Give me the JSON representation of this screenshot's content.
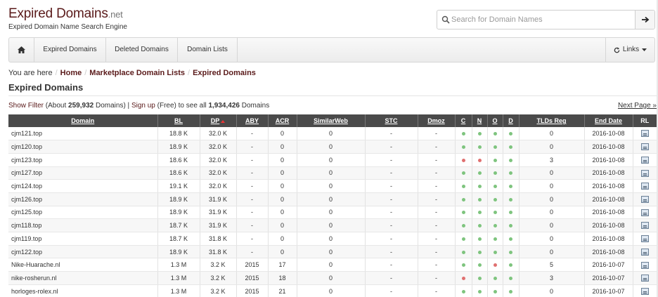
{
  "header": {
    "logo_main": "Expired Domains",
    "logo_tld": ".net",
    "tagline": "Expired Domain Name Search Engine",
    "search_placeholder": "Search for Domain Names"
  },
  "nav": {
    "items": [
      "Expired Domains",
      "Deleted Domains",
      "Domain Lists"
    ],
    "links_label": "Links"
  },
  "breadcrumb": {
    "prefix": "You are here",
    "items": [
      "Home",
      "Marketplace Domain Lists",
      "Expired Domains"
    ]
  },
  "page_title": "Expired Domains",
  "info": {
    "show_filter": "Show Filter",
    "about_prefix": "(About ",
    "count": "259,932",
    "count_suffix": " Domains) | ",
    "sign_up": "Sign up",
    "free_text": " (Free) to see all ",
    "total": "1,934,426",
    "total_suffix": " Domains",
    "next_page": "Next Page »"
  },
  "table": {
    "columns": [
      "Domain",
      "BL",
      "DP",
      "ABY",
      "ACR",
      "SimilarWeb",
      "STC",
      "Dmoz",
      "C",
      "N",
      "O",
      "D",
      "TLDs Reg",
      "End Date",
      "RL"
    ],
    "rows": [
      {
        "domain": "cjm121.top",
        "bl": "18.8 K",
        "dp": "32.0 K",
        "aby": "-",
        "acr": "0",
        "similarweb": "0",
        "stc": "-",
        "dmoz": "-",
        "c": "green",
        "n": "green",
        "o": "green",
        "d": "green",
        "tlds": "0",
        "end": "2016-10-08"
      },
      {
        "domain": "cjm120.top",
        "bl": "18.9 K",
        "dp": "32.0 K",
        "aby": "-",
        "acr": "0",
        "similarweb": "0",
        "stc": "-",
        "dmoz": "-",
        "c": "green",
        "n": "green",
        "o": "green",
        "d": "green",
        "tlds": "0",
        "end": "2016-10-08"
      },
      {
        "domain": "cjm123.top",
        "bl": "18.6 K",
        "dp": "32.0 K",
        "aby": "-",
        "acr": "0",
        "similarweb": "0",
        "stc": "-",
        "dmoz": "-",
        "c": "red",
        "n": "red",
        "o": "green",
        "d": "green",
        "tlds": "3",
        "end": "2016-10-08"
      },
      {
        "domain": "cjm127.top",
        "bl": "18.6 K",
        "dp": "32.0 K",
        "aby": "-",
        "acr": "0",
        "similarweb": "0",
        "stc": "-",
        "dmoz": "-",
        "c": "green",
        "n": "green",
        "o": "green",
        "d": "green",
        "tlds": "0",
        "end": "2016-10-08"
      },
      {
        "domain": "cjm124.top",
        "bl": "19.1 K",
        "dp": "32.0 K",
        "aby": "-",
        "acr": "0",
        "similarweb": "0",
        "stc": "-",
        "dmoz": "-",
        "c": "green",
        "n": "green",
        "o": "green",
        "d": "green",
        "tlds": "0",
        "end": "2016-10-08"
      },
      {
        "domain": "cjm126.top",
        "bl": "18.9 K",
        "dp": "31.9 K",
        "aby": "-",
        "acr": "0",
        "similarweb": "0",
        "stc": "-",
        "dmoz": "-",
        "c": "green",
        "n": "green",
        "o": "green",
        "d": "green",
        "tlds": "0",
        "end": "2016-10-08"
      },
      {
        "domain": "cjm125.top",
        "bl": "18.9 K",
        "dp": "31.9 K",
        "aby": "-",
        "acr": "0",
        "similarweb": "0",
        "stc": "-",
        "dmoz": "-",
        "c": "green",
        "n": "green",
        "o": "green",
        "d": "green",
        "tlds": "0",
        "end": "2016-10-08"
      },
      {
        "domain": "cjm118.top",
        "bl": "18.7 K",
        "dp": "31.9 K",
        "aby": "-",
        "acr": "0",
        "similarweb": "0",
        "stc": "-",
        "dmoz": "-",
        "c": "green",
        "n": "green",
        "o": "green",
        "d": "green",
        "tlds": "0",
        "end": "2016-10-08"
      },
      {
        "domain": "cjm119.top",
        "bl": "18.7 K",
        "dp": "31.8 K",
        "aby": "-",
        "acr": "0",
        "similarweb": "0",
        "stc": "-",
        "dmoz": "-",
        "c": "green",
        "n": "green",
        "o": "green",
        "d": "green",
        "tlds": "0",
        "end": "2016-10-08"
      },
      {
        "domain": "cjm122.top",
        "bl": "18.9 K",
        "dp": "31.8 K",
        "aby": "-",
        "acr": "0",
        "similarweb": "0",
        "stc": "-",
        "dmoz": "-",
        "c": "green",
        "n": "green",
        "o": "green",
        "d": "green",
        "tlds": "0",
        "end": "2016-10-08"
      },
      {
        "domain": "Nike-Huarache.nl",
        "bl": "1.3 M",
        "dp": "3.2 K",
        "aby": "2015",
        "acr": "17",
        "similarweb": "0",
        "stc": "-",
        "dmoz": "-",
        "c": "green",
        "n": "green",
        "o": "red",
        "d": "green",
        "tlds": "5",
        "end": "2016-10-07"
      },
      {
        "domain": "nike-rosherun.nl",
        "bl": "1.3 M",
        "dp": "3.2 K",
        "aby": "2015",
        "acr": "18",
        "similarweb": "0",
        "stc": "-",
        "dmoz": "-",
        "c": "red",
        "n": "green",
        "o": "green",
        "d": "green",
        "tlds": "3",
        "end": "2016-10-07"
      },
      {
        "domain": "horloges-rolex.nl",
        "bl": "1.3 M",
        "dp": "3.2 K",
        "aby": "2015",
        "acr": "21",
        "similarweb": "0",
        "stc": "-",
        "dmoz": "-",
        "c": "green",
        "n": "green",
        "o": "green",
        "d": "green",
        "tlds": "0",
        "end": "2016-10-07"
      }
    ]
  },
  "colors": {
    "brand": "#5a1a1a",
    "header_bg": "#4a4a4a",
    "status_green": "#7ec47e",
    "status_red": "#e07070"
  }
}
